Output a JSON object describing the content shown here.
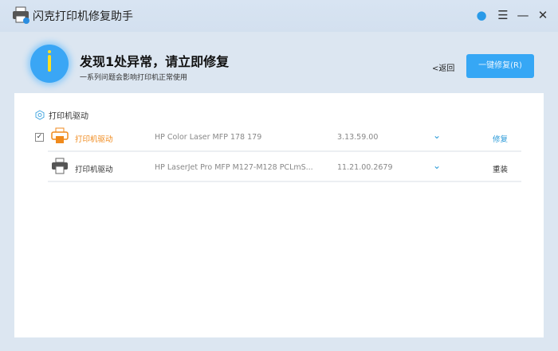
{
  "app": {
    "title": "闪克打印机修复助手"
  },
  "window": {
    "user_icon": "user-icon",
    "menu_icon": "menu-icon",
    "minimize_icon": "minimize-icon",
    "close_icon": "close-icon"
  },
  "header": {
    "title": "发现1处异常，请立即修复",
    "subtitle": "一系列问题会影响打印机正常使用",
    "back_label": "<返回",
    "fix_all_label": "一键修复(R)"
  },
  "section": {
    "label": "打印机驱动"
  },
  "colors": {
    "accent": "#36a7f5",
    "warning": "#f08a1c"
  },
  "rows": [
    {
      "checked": true,
      "name": "打印机驱动",
      "model": "HP Color Laser MFP 178 179",
      "version": "3.13.59.00",
      "action": "修复",
      "status": "error"
    },
    {
      "checked": false,
      "name": "打印机驱动",
      "model": "HP LaserJet Pro MFP M127-M128 PCLmS...",
      "version": "11.21.00.2679",
      "action": "重装",
      "status": "ok"
    }
  ]
}
